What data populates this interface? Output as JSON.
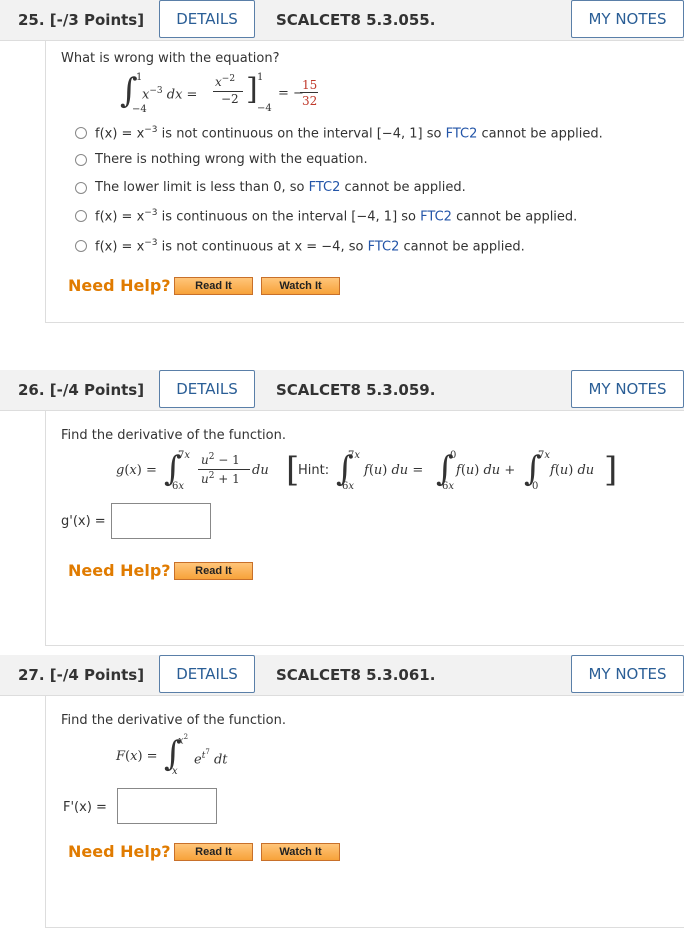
{
  "q25": {
    "number": "25. [-/3 Points]",
    "details": "DETAILS",
    "code": "SCALCET8 5.3.055.",
    "mynotes": "MY NOTES",
    "prompt": "What is wrong with the equation?",
    "options": [
      {
        "pre": "f(x) = x",
        "sup": "−3",
        "post": " is not continuous on the interval [−4, 1] so ",
        "ftc": "FTC2",
        "end": " cannot be applied."
      },
      {
        "pre": "There is nothing wrong with the equation.",
        "sup": "",
        "post": "",
        "ftc": "",
        "end": ""
      },
      {
        "pre": "The lower limit is less than 0, so ",
        "sup": "",
        "post": "",
        "ftc": "FTC2",
        "end": " cannot be applied."
      },
      {
        "pre": "f(x) = x",
        "sup": "−3",
        "post": " is continuous on the interval [−4, 1] so ",
        "ftc": "FTC2",
        "end": " cannot be applied."
      },
      {
        "pre": "f(x) = x",
        "sup": "−3",
        "post": " is not continuous at x = −4, so ",
        "ftc": "FTC2",
        "end": " cannot be applied."
      }
    ],
    "need_help": "Need Help?",
    "read_it": "Read It",
    "watch_it": "Watch It"
  },
  "q26": {
    "number": "26. [-/4 Points]",
    "details": "DETAILS",
    "code": "SCALCET8 5.3.059.",
    "mynotes": "MY NOTES",
    "prompt": "Find the derivative of the function.",
    "answer_label": "g'(x) =",
    "answer_value": "",
    "need_help": "Need Help?",
    "read_it": "Read It"
  },
  "q27": {
    "number": "27. [-/4 Points]",
    "details": "DETAILS",
    "code": "SCALCET8 5.3.061.",
    "mynotes": "MY NOTES",
    "prompt": "Find the derivative of the function.",
    "answer_label": "F'(x) =",
    "answer_value": "",
    "need_help": "Need Help?",
    "read_it": "Read It",
    "watch_it": "Watch It"
  },
  "colors": {
    "accent_orange": "#e07b00",
    "link_blue": "#2355a8",
    "header_bg": "#f2f2f2"
  }
}
